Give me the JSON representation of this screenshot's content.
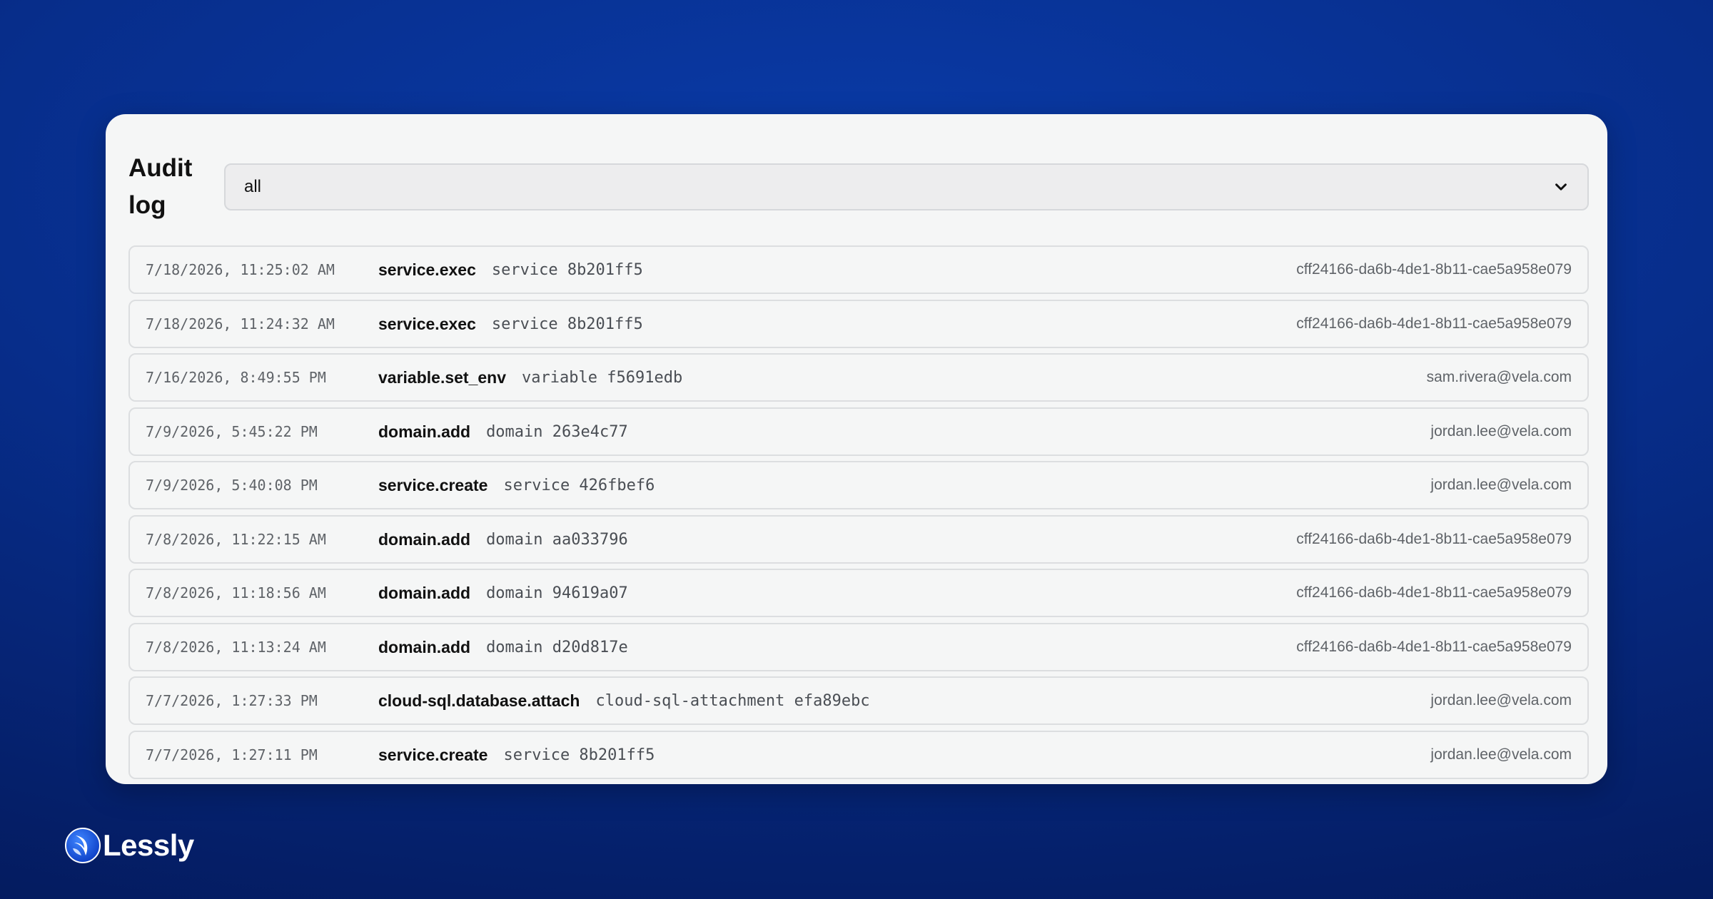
{
  "audit": {
    "title": "Audit log",
    "filter": {
      "selected": "all"
    },
    "entries": [
      {
        "timestamp": "7/18/2026, 11:25:02 AM",
        "action": "service.exec",
        "target": "service 8b201ff5",
        "actor": "cff24166-da6b-4de1-8b11-cae5a958e079"
      },
      {
        "timestamp": "7/18/2026, 11:24:32 AM",
        "action": "service.exec",
        "target": "service 8b201ff5",
        "actor": "cff24166-da6b-4de1-8b11-cae5a958e079"
      },
      {
        "timestamp": "7/16/2026, 8:49:55 PM",
        "action": "variable.set_env",
        "target": "variable f5691edb",
        "actor": "sam.rivera@vela.com"
      },
      {
        "timestamp": "7/9/2026, 5:45:22 PM",
        "action": "domain.add",
        "target": "domain 263e4c77",
        "actor": "jordan.lee@vela.com"
      },
      {
        "timestamp": "7/9/2026, 5:40:08 PM",
        "action": "service.create",
        "target": "service 426fbef6",
        "actor": "jordan.lee@vela.com"
      },
      {
        "timestamp": "7/8/2026, 11:22:15 AM",
        "action": "domain.add",
        "target": "domain aa033796",
        "actor": "cff24166-da6b-4de1-8b11-cae5a958e079"
      },
      {
        "timestamp": "7/8/2026, 11:18:56 AM",
        "action": "domain.add",
        "target": "domain 94619a07",
        "actor": "cff24166-da6b-4de1-8b11-cae5a958e079"
      },
      {
        "timestamp": "7/8/2026, 11:13:24 AM",
        "action": "domain.add",
        "target": "domain d20d817e",
        "actor": "cff24166-da6b-4de1-8b11-cae5a958e079"
      },
      {
        "timestamp": "7/7/2026, 1:27:33 PM",
        "action": "cloud-sql.database.attach",
        "target": "cloud-sql-attachment efa89ebc",
        "actor": "jordan.lee@vela.com"
      },
      {
        "timestamp": "7/7/2026, 1:27:11 PM",
        "action": "service.create",
        "target": "service 8b201ff5",
        "actor": "jordan.lee@vela.com"
      }
    ]
  },
  "brand": {
    "name": "Lessly",
    "icon": "lessly-logo-icon"
  },
  "colors": {
    "background": "#072d8a",
    "panel": "#f5f6f6",
    "row_border": "#dcdee0",
    "text_primary": "#111111",
    "text_muted": "#5f6368"
  }
}
